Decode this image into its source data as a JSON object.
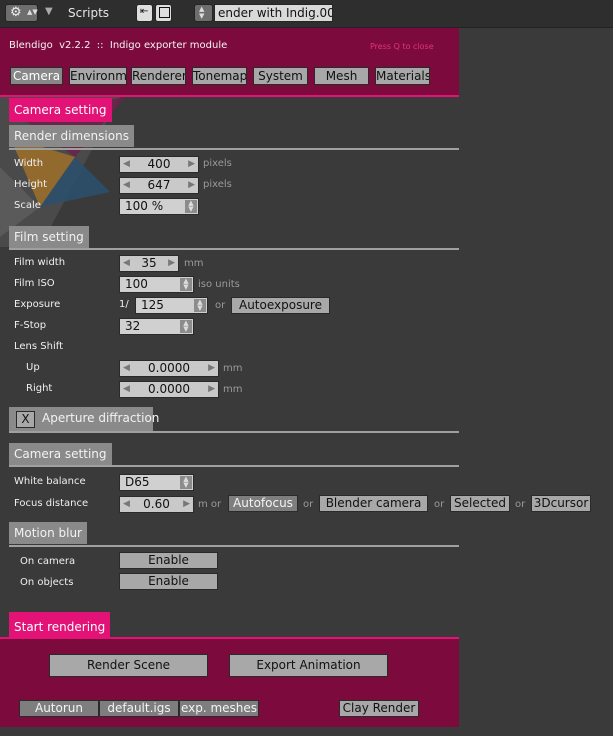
{
  "header": {
    "menu_label": "Scripts",
    "script_name": "ender with Indig.001"
  },
  "app": {
    "title": "Blendigo  v2.2.2  ::  Indigo exporter module",
    "close_hint": "Press Q to close"
  },
  "tabs": [
    "Camera",
    "Environm",
    "Renderer",
    "Tonemap",
    "System",
    "Mesh",
    "Materials"
  ],
  "camera_setting_title": "Camera setting",
  "render_dimensions": {
    "title": "Render dimensions",
    "width_label": "Width",
    "width_value": "400",
    "width_unit": "pixels",
    "height_label": "Height",
    "height_value": "647",
    "height_unit": "pixels",
    "scale_label": "Scale",
    "scale_value": "100 %"
  },
  "film": {
    "title": "Film setting",
    "film_width_label": "Film width",
    "film_width_value": "35",
    "film_width_unit": "mm",
    "iso_label": "Film ISO",
    "iso_value": "100",
    "iso_unit": "iso units",
    "exposure_label": "Exposure",
    "exposure_prefix": "1/",
    "exposure_value": "125",
    "or": "or",
    "autoexposure_button": "Autoexposure",
    "fstop_label": "F-Stop",
    "fstop_value": "32",
    "lens_shift_label": "Lens Shift",
    "up_label": "Up",
    "up_value": "0.0000",
    "up_unit": "mm",
    "right_label": "Right",
    "right_value": "0.0000",
    "right_unit": "mm"
  },
  "aperture": {
    "check": "X",
    "label": "Aperture diffraction"
  },
  "camera2": {
    "title": "Camera setting",
    "wb_label": "White balance",
    "wb_value": "D65",
    "focus_label": "Focus distance",
    "focus_value": "0.60",
    "focus_unit": "m or",
    "autofocus_button": "Autofocus",
    "or": "or",
    "blender_camera_button": "Blender camera",
    "selected_button": "Selected",
    "cursor_button": "3Dcursor"
  },
  "motion_blur": {
    "title": "Motion blur",
    "on_camera_label": "On camera",
    "on_camera_button": "Enable",
    "on_objects_label": "On objects",
    "on_objects_button": "Enable"
  },
  "start": {
    "title": "Start rendering",
    "render_scene_button": "Render Scene",
    "export_animation_button": "Export Animation",
    "autorun_button": "Autorun",
    "default_igs_button": "default.igs",
    "exp_meshes_button": "exp. meshes",
    "clay_render_button": "Clay Render"
  },
  "colors": {
    "panel_magenta": "#7d0a3c",
    "accent_pink": "#e21277",
    "background": "#3a3a3a"
  }
}
